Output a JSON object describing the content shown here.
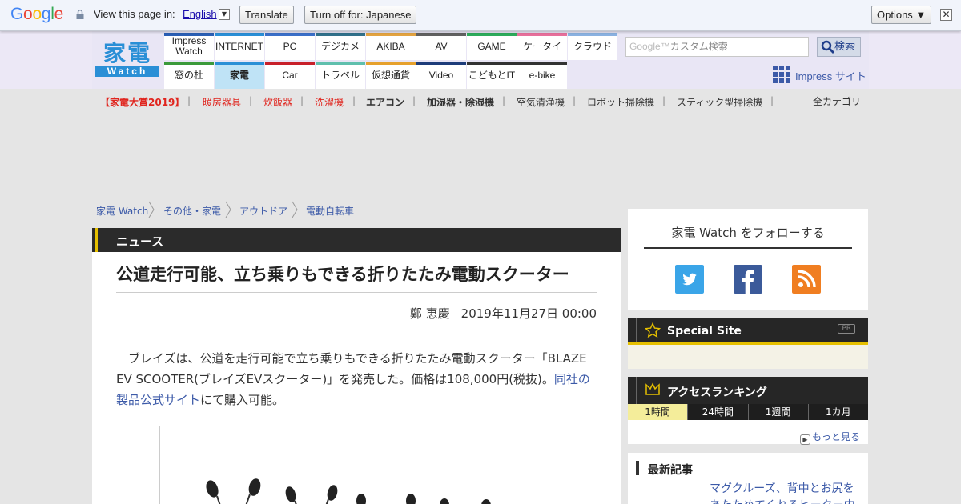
{
  "translate_bar": {
    "logo": "Google",
    "prompt": "View this page in:",
    "language": "English",
    "translate_button": "Translate",
    "turn_off_button": "Turn off for: Japanese",
    "options_button": "Options ▼",
    "close_symbol": "✕"
  },
  "header": {
    "logo_top": "家電",
    "logo_bottom": "Watch",
    "tabs_top": [
      {
        "label": "Impress Watch",
        "color": "#2b5fb4"
      },
      {
        "label": "INTERNET",
        "color": "#2a8fd6"
      },
      {
        "label": "PC",
        "color": "#3a6fc8"
      },
      {
        "label": "デジカメ",
        "color": "#31708a"
      },
      {
        "label": "AKIBA",
        "color": "#e2a340"
      },
      {
        "label": "AV",
        "color": "#606060"
      },
      {
        "label": "GAME",
        "color": "#2caa5a"
      },
      {
        "label": "ケータイ",
        "color": "#e76f9b"
      },
      {
        "label": "クラウド",
        "color": "#8ab1e0"
      }
    ],
    "tabs_bottom": [
      {
        "label": "窓の杜",
        "color": "#3b9a3b"
      },
      {
        "label": "家電",
        "color": "#2a8fd6"
      },
      {
        "label": "Car",
        "color": "#c8202a"
      },
      {
        "label": "トラベル",
        "color": "#5fbfad"
      },
      {
        "label": "仮想通貨",
        "color": "#e6a12d"
      },
      {
        "label": "Video",
        "color": "#1d3c7a"
      },
      {
        "label": "こどもとIT",
        "color": "#333333"
      },
      {
        "label": "e-bike",
        "color": "#333333"
      }
    ],
    "search_brand": "Google™",
    "search_placeholder": "カスタム検索",
    "search_button": "検索",
    "impress_site": "Impress サイト"
  },
  "subnav": {
    "items": [
      "【家電大賞2019】",
      "暖房器具",
      "炊飯器",
      "洗濯機",
      "エアコン",
      "加湿器・除湿機",
      "空気清浄機",
      "ロボット掃除機",
      "スティック型掃除機"
    ],
    "all_categories": "全カテゴリ"
  },
  "breadcrumb": [
    "家電 Watch",
    "その他・家電",
    "アウトドア",
    "電動自転車"
  ],
  "article": {
    "section": "ニュース",
    "title": "公道走行可能、立ち乗りもできる折りたたみ電動スクーター",
    "author": "鄭 恵慶",
    "date": "2019年11月27日 00:00",
    "body_1": "　ブレイズは、公道を走行可能で立ち乗りもできる折りたたみ電動スクーター「BLAZE EV SCOOTER(ブレイズEVスクーター)」を発売した。価格は108,000円(税抜)。",
    "body_link": "同社の製品公式サイト",
    "body_2": "にて購入可能。"
  },
  "sidebar": {
    "follow_title": "家電 Watch をフォローする",
    "social": [
      "twitter-icon",
      "facebook-icon",
      "rss-icon"
    ],
    "special_site": "Special Site",
    "pr_badge": "PR",
    "ranking_title": "アクセスランキング",
    "ranking_tabs": [
      "1時間",
      "24時間",
      "1週間",
      "1カ月"
    ],
    "more": "もっと見る",
    "latest_title": "最新記事",
    "latest_item": "マグクルーズ、背中とお尻をあたためてくれるヒーター内"
  }
}
